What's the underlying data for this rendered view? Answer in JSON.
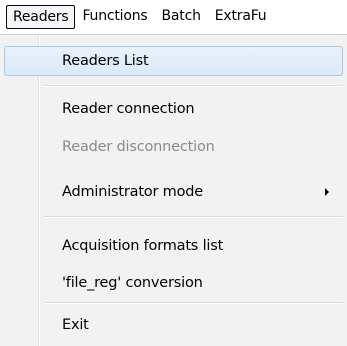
{
  "menubar": {
    "items": [
      {
        "label": "Readers"
      },
      {
        "label": "Functions"
      },
      {
        "label": "Batch"
      },
      {
        "label": "ExtraFu"
      }
    ]
  },
  "menu": {
    "items": [
      {
        "label": "Readers List",
        "state": "highlighted"
      },
      {
        "label": "Reader connection",
        "state": "enabled"
      },
      {
        "label": "Reader disconnection",
        "state": "disabled"
      },
      {
        "label": "Administrator mode",
        "state": "enabled",
        "submenu_icon": "submenu-arrow-icon"
      },
      {
        "label": "Acquisition formats list",
        "state": "enabled"
      },
      {
        "label": "'file_reg' conversion",
        "state": "enabled"
      },
      {
        "label": "Exit",
        "state": "enabled"
      }
    ]
  },
  "colors": {
    "menu_background": "#f2f2f2",
    "highlight_background": "#dce9f7",
    "highlight_border": "#a8c8ea",
    "disabled_text": "#8a8a8a"
  }
}
